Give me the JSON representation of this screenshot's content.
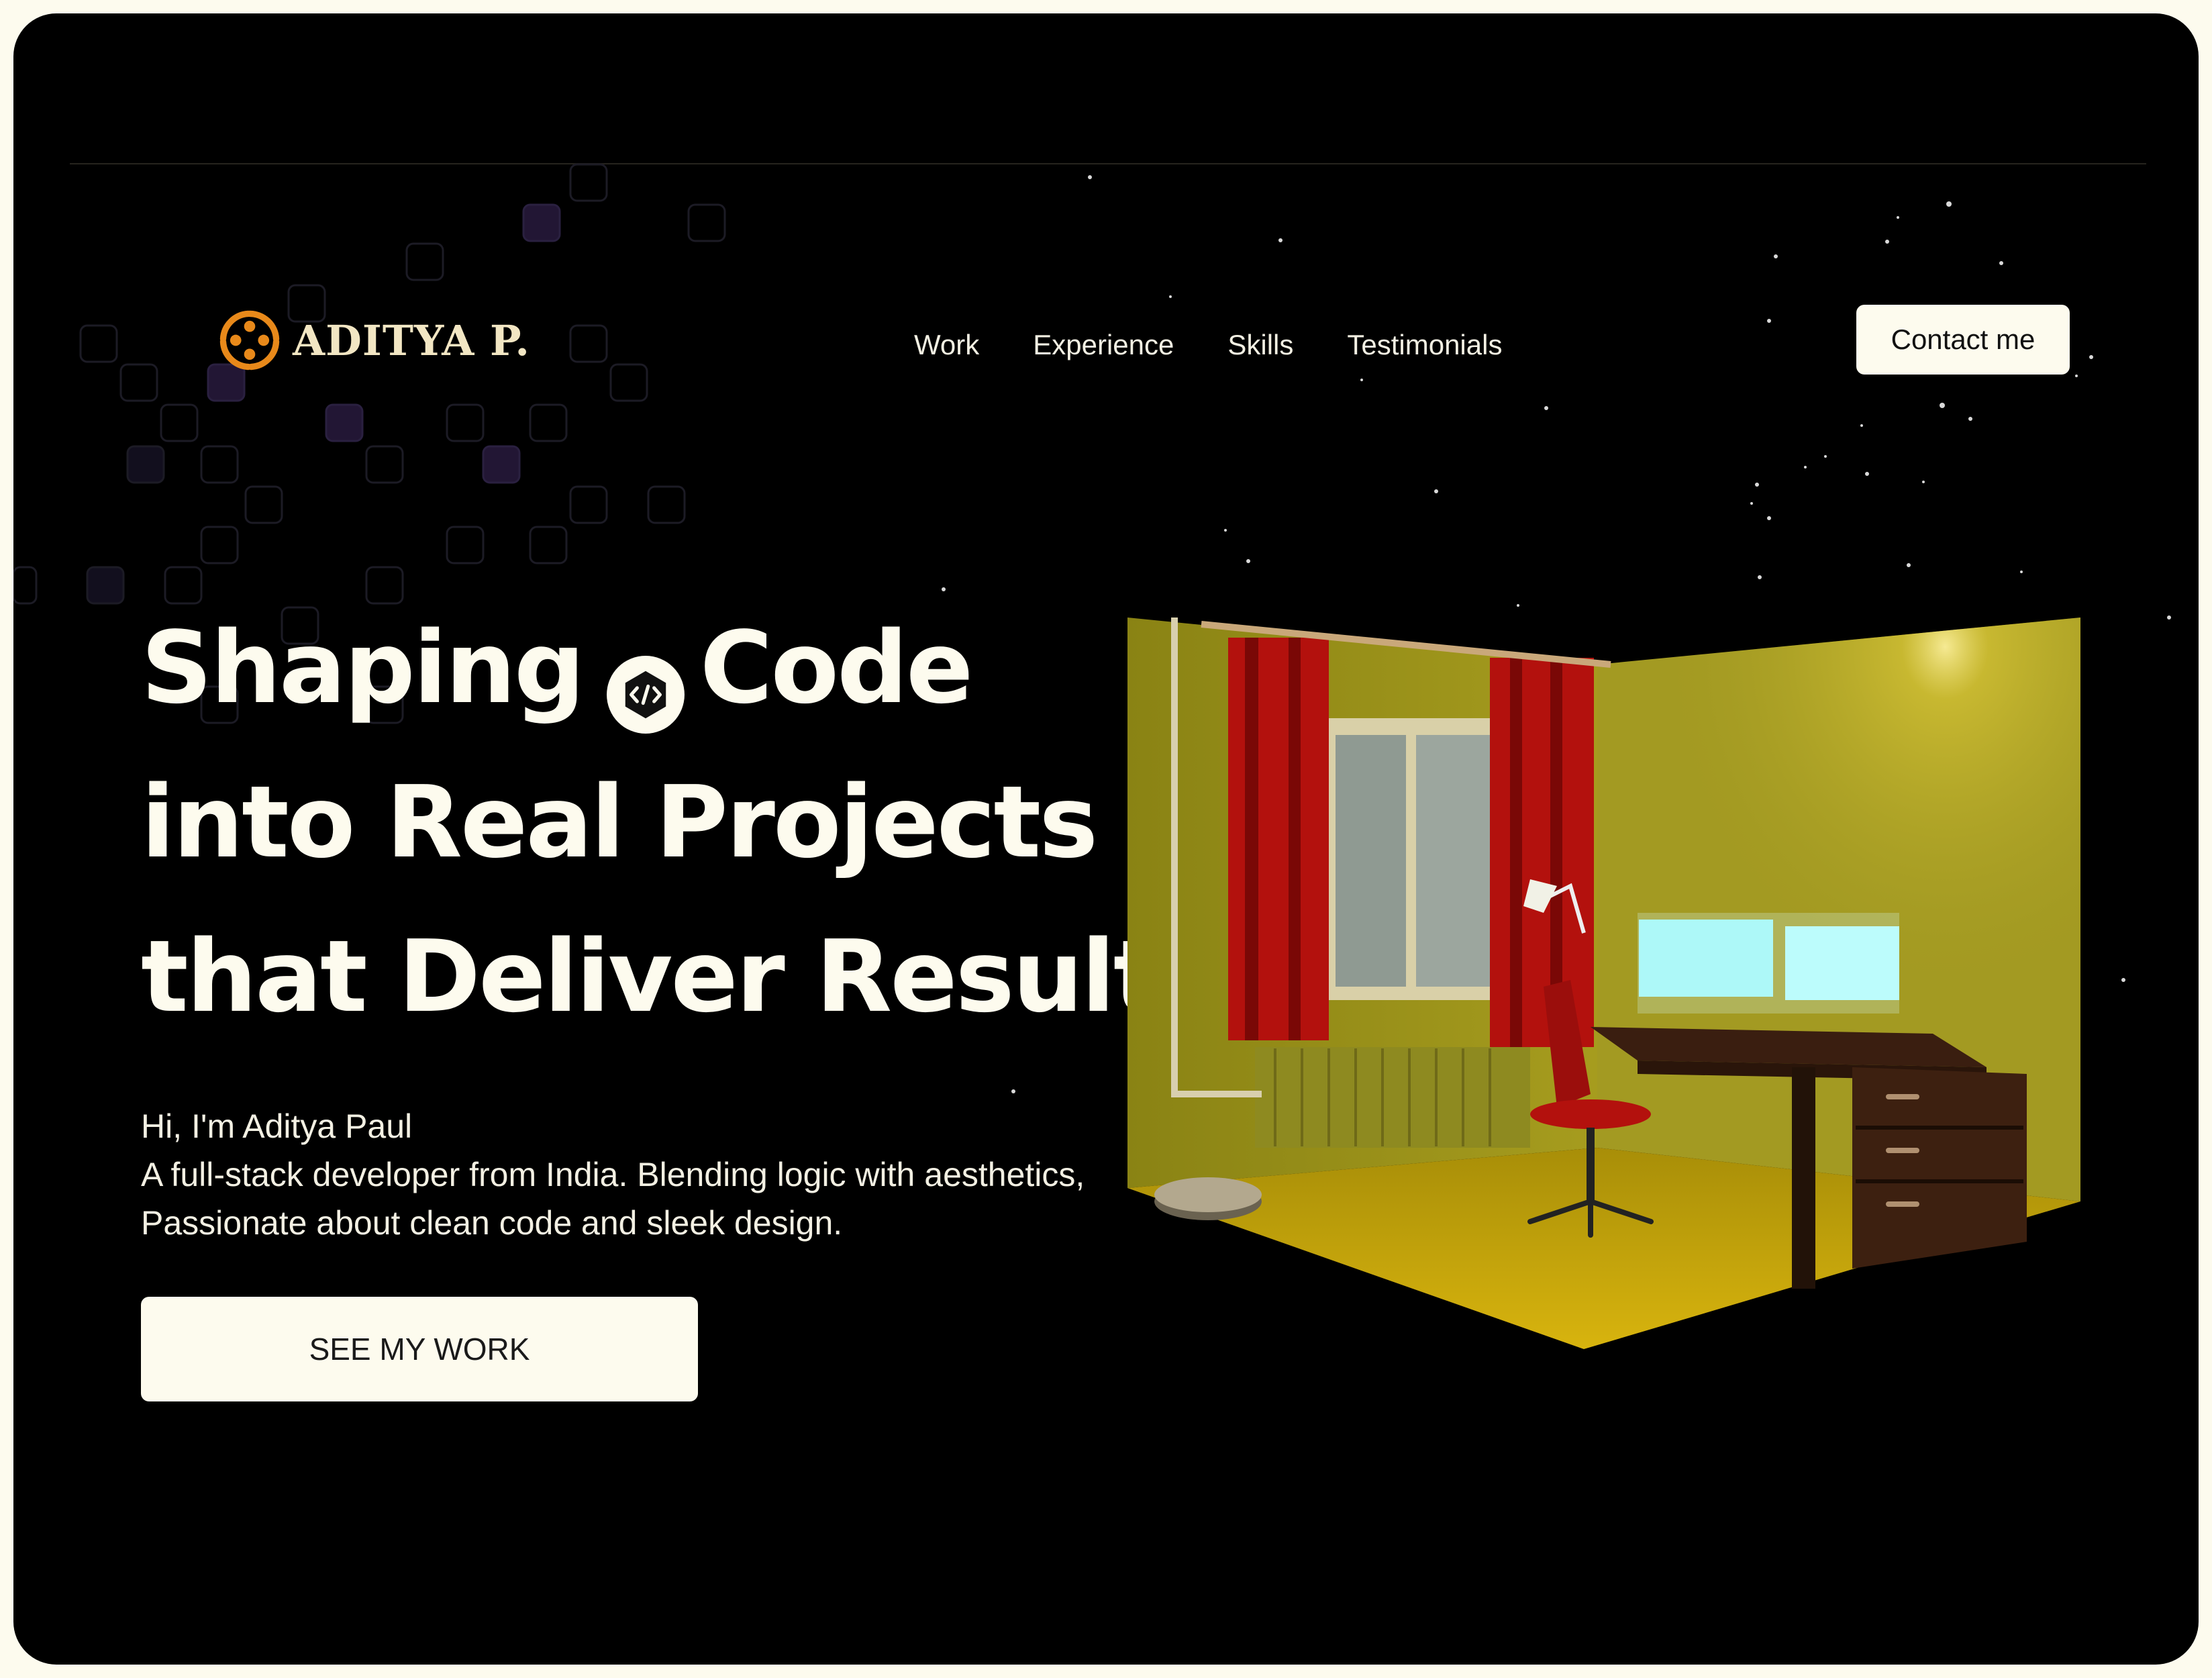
{
  "brand": {
    "name": "ADITYA P.",
    "logo_icon": "swirl-logo-icon",
    "accent": "#e8891a"
  },
  "nav": {
    "items": [
      "Work",
      "Experience",
      "Skills",
      "Testimonials"
    ]
  },
  "header": {
    "contact_label": "Contact me"
  },
  "hero": {
    "headline_word1": "Shaping",
    "headline_word2": "Code",
    "headline_line2": "into Real Projects",
    "headline_line3": "that Deliver Results",
    "code_icon": "code-brackets-icon",
    "greeting": "Hi, I'm Aditya Paul",
    "bio_line1": "A full-stack developer from India. Blending logic with aesthetics,",
    "bio_line2": "Passionate about clean code and sleek design.",
    "cta_label": "SEE MY WORK"
  },
  "illustration": {
    "name": "3d-room-illustration",
    "wall_color": "#a39a22",
    "floor_color": "#c8a60c",
    "curtain_color": "#b3110d"
  },
  "colors": {
    "background": "#000000",
    "text": "#fdfbee",
    "button_bg": "#fdfbee"
  }
}
